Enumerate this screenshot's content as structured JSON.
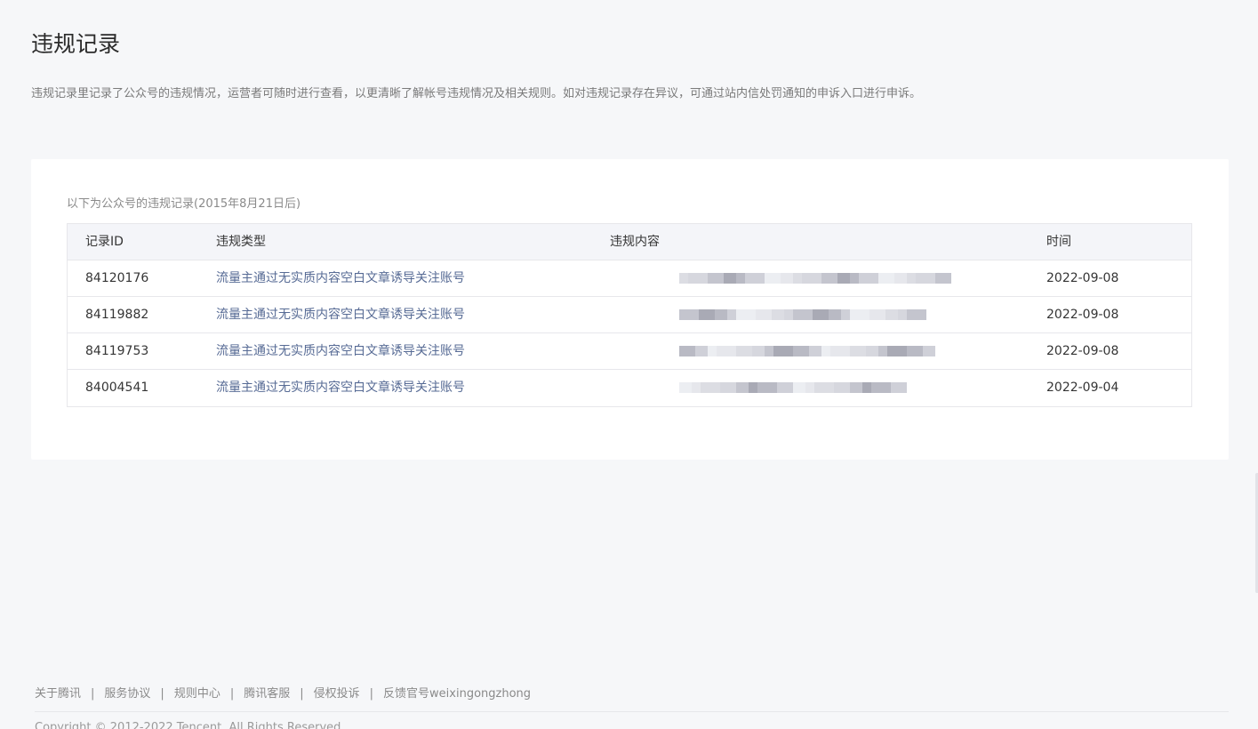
{
  "page": {
    "title": "违规记录",
    "description": "违规记录里记录了公众号的违规情况，运营者可随时进行查看，以更清晰了解帐号违规情况及相关规则。如对违规记录存在异议，可通过站内信处罚通知的申诉入口进行申诉。"
  },
  "records": {
    "subtitle": "以下为公众号的违规记录(2015年8月21日后)",
    "headers": {
      "id": "记录ID",
      "type": "违规类型",
      "content": "违规内容",
      "time": "时间"
    },
    "rows": [
      {
        "id": "84120176",
        "type": "流量主通过无实质内容空白文章诱导关注账号",
        "time": "2022-09-08"
      },
      {
        "id": "84119882",
        "type": "流量主通过无实质内容空白文章诱导关注账号",
        "time": "2022-09-08"
      },
      {
        "id": "84119753",
        "type": "流量主通过无实质内容空白文章诱导关注账号",
        "time": "2022-09-08"
      },
      {
        "id": "84004541",
        "type": "流量主通过无实质内容空白文章诱导关注账号",
        "time": "2022-09-04"
      }
    ]
  },
  "footer": {
    "links": [
      "关于腾讯",
      "服务协议",
      "规则中心",
      "腾讯客服",
      "侵权投诉",
      "反馈官号weixingongzhong"
    ],
    "separator": "|",
    "copyright": "Copyright © 2012-2022 Tencent. All Rights Reserved."
  },
  "colors": {
    "link": "#576b95",
    "background": "#f6f7f9",
    "card": "#ffffff",
    "table_header": "#f4f5f9",
    "border": "#e7e7eb"
  }
}
